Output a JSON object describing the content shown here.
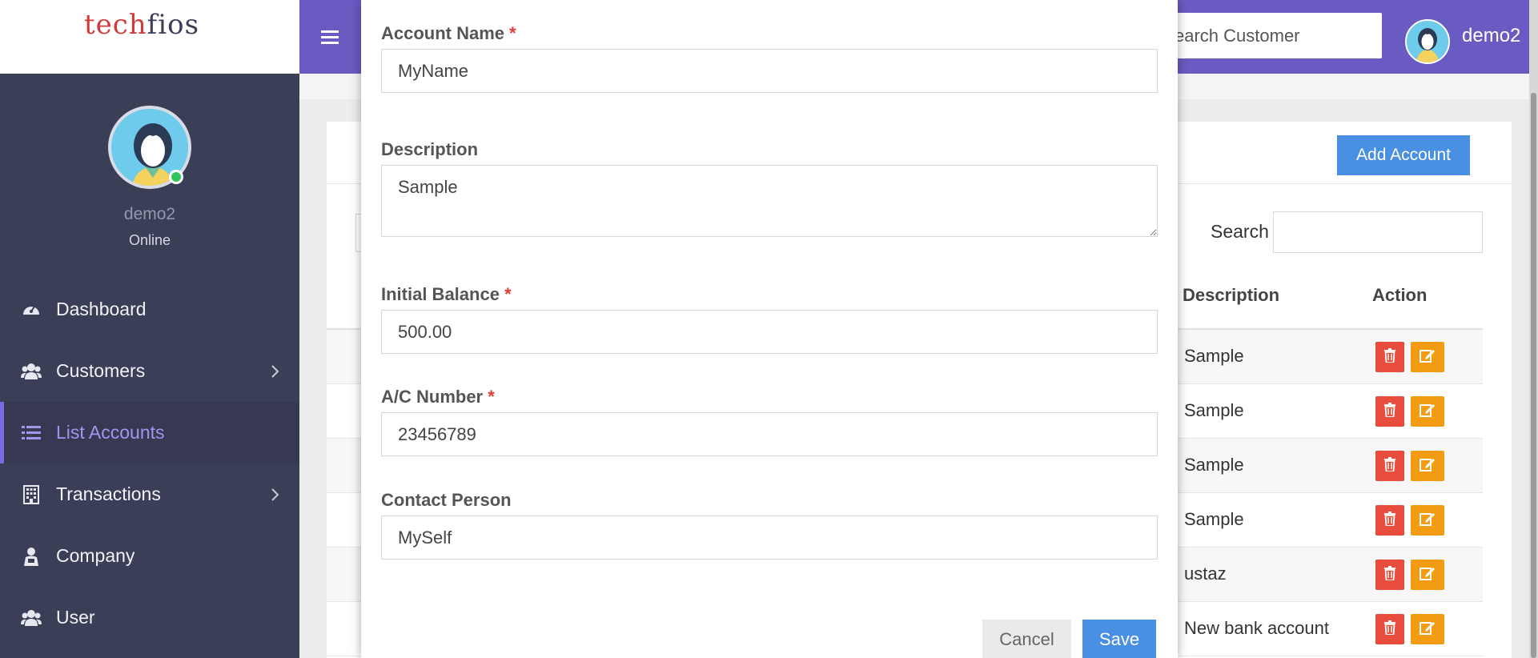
{
  "app": {
    "logo_part1": "tech",
    "logo_part2": "fios"
  },
  "sidebar": {
    "user_name": "demo2",
    "user_status": "Online",
    "items": [
      {
        "label": "Dashboard",
        "icon": "dashboard-icon"
      },
      {
        "label": "Customers",
        "icon": "users-icon",
        "has_submenu": true
      },
      {
        "label": "List Accounts",
        "icon": "list-icon",
        "active": true
      },
      {
        "label": "Transactions",
        "icon": "building-icon",
        "has_submenu": true
      },
      {
        "label": "Company",
        "icon": "briefcase-icon"
      },
      {
        "label": "User",
        "icon": "users-icon"
      }
    ]
  },
  "header": {
    "search_placeholder": "earch Customer",
    "user_name": "demo2"
  },
  "panel": {
    "add_button": "Add Account",
    "search_label": "Search",
    "columns": {
      "description": "Description",
      "action": "Action"
    },
    "rows": [
      {
        "description": "Sample"
      },
      {
        "description": "Sample"
      },
      {
        "description": "Sample"
      },
      {
        "description": "Sample"
      },
      {
        "description": "ustaz"
      },
      {
        "description": "New bank account"
      }
    ]
  },
  "modal": {
    "account_name_label": "Account Name",
    "account_name_value": "MyName",
    "description_label": "Description",
    "description_value": "Sample",
    "initial_balance_label": "Initial Balance",
    "initial_balance_value": "500.00",
    "ac_number_label": "A/C Number",
    "ac_number_value": "23456789",
    "contact_person_label": "Contact Person",
    "contact_person_value": "MySelf",
    "required_mark": "*",
    "cancel_label": "Cancel",
    "save_label": "Save"
  },
  "colors": {
    "sidebar_bg": "#3b3e57",
    "header_bg": "#6a5bc3",
    "primary": "#4a90e2",
    "danger": "#e74c3c",
    "warning": "#f39c12",
    "active_nav": "#a394f0"
  }
}
